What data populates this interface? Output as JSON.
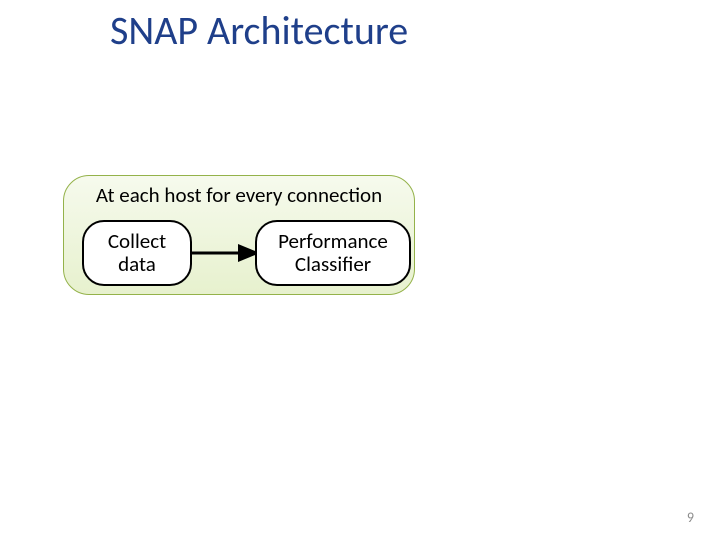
{
  "title": "SNAP Architecture",
  "panel": {
    "heading": "At each host for every connection",
    "box1_line1": "Collect",
    "box1_line2": "data",
    "box2_line1": "Performance",
    "box2_line2": "Classifier"
  },
  "page_number": "9"
}
